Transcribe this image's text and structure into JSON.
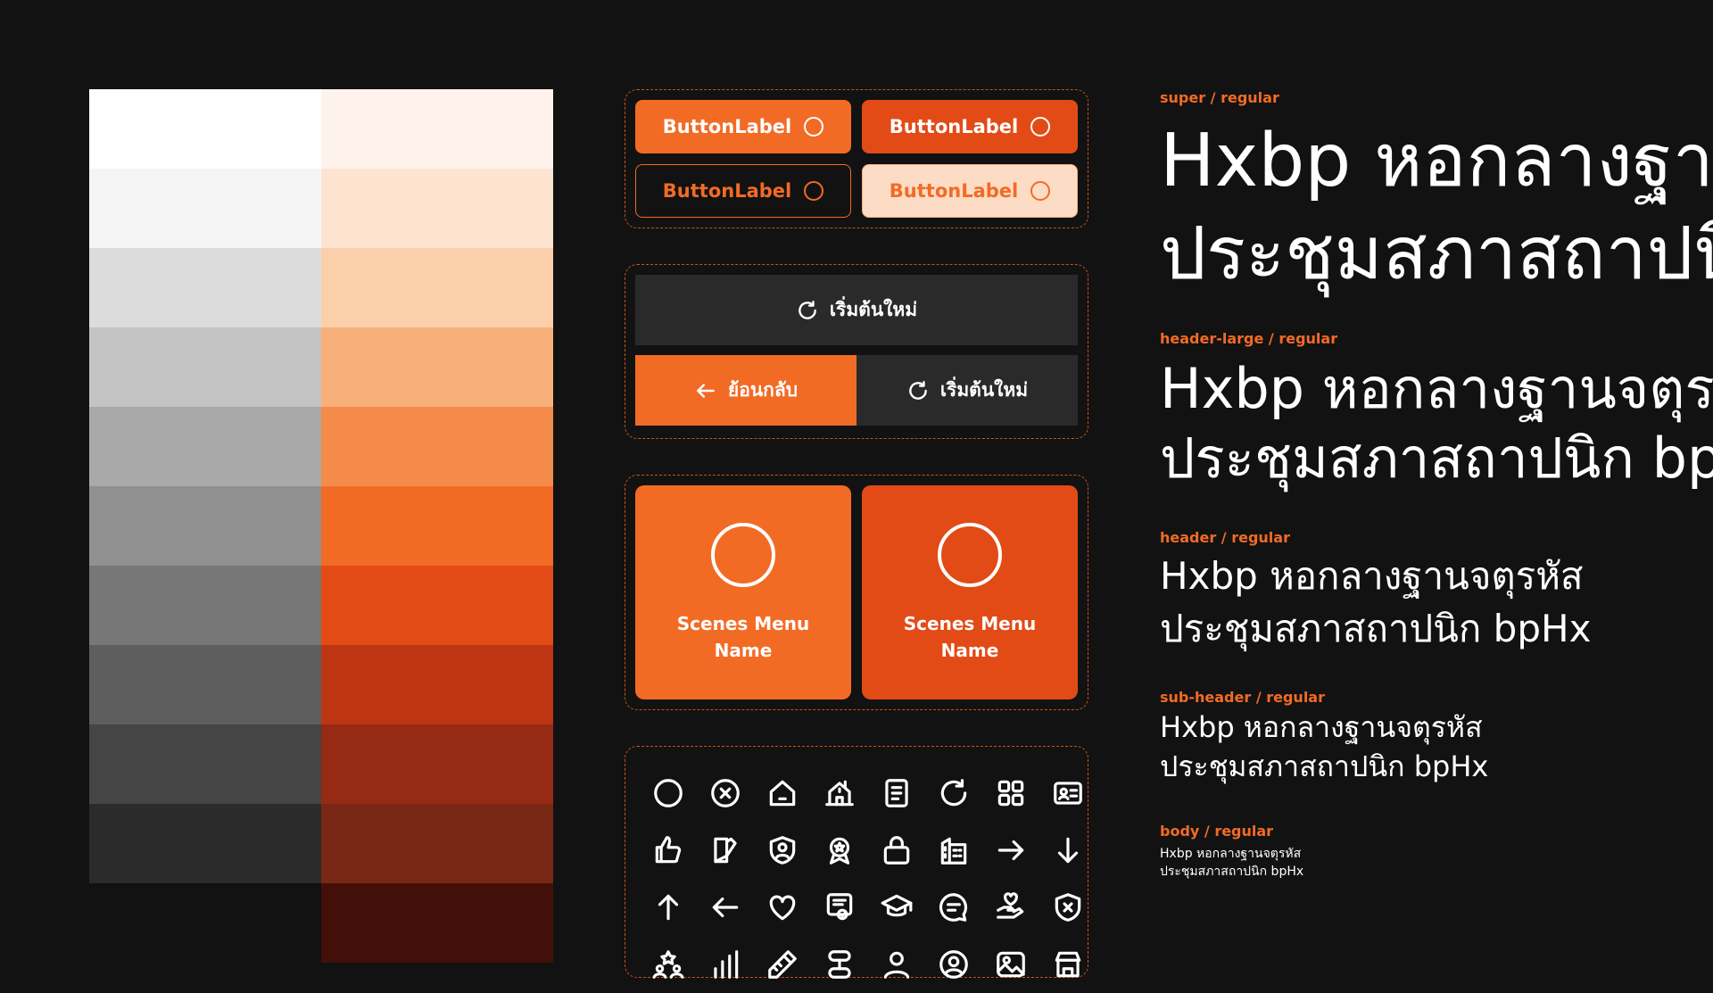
{
  "palette": {
    "gray": [
      "#ffffff",
      "#f5f5f5",
      "#dcdcdc",
      "#c3c3c3",
      "#a9a9a9",
      "#909090",
      "#777777",
      "#5e5e5e",
      "#454545",
      "#2b2b2b"
    ],
    "orange": [
      "#fef3ec",
      "#fde4d0",
      "#fbcfa9",
      "#f8b07b",
      "#f58b4a",
      "#f26b25",
      "#e24b16",
      "#bd3513",
      "#962a15",
      "#792815",
      "#421009"
    ]
  },
  "buttons": [
    {
      "label": "ButtonLabel",
      "style": "filled-orange"
    },
    {
      "label": "ButtonLabel",
      "style": "filled-deep-orange"
    },
    {
      "label": "ButtonLabel",
      "style": "outline"
    },
    {
      "label": "ButtonLabel",
      "style": "light"
    }
  ],
  "actions": {
    "restart_label": "เริ่มต้นใหม่",
    "back_label": "ย้อนกลับ",
    "restart_icon": "refresh-icon",
    "back_icon": "arrow-left-icon"
  },
  "tiles": [
    {
      "line1": "Scenes Menu",
      "line2": "Name"
    },
    {
      "line1": "Scenes Menu",
      "line2": "Name"
    }
  ],
  "icons": [
    "circle-icon",
    "close-circle-icon",
    "home-icon",
    "house-building-icon",
    "document-icon",
    "refresh-icon",
    "grid-icon",
    "id-card-icon",
    "thumbs-up-icon",
    "book-edit-icon",
    "shield-user-icon",
    "award-icon",
    "lock-icon",
    "office-building-icon",
    "arrow-right-icon",
    "arrow-down-icon",
    "arrow-up-icon",
    "arrow-left-icon",
    "heart-icon",
    "certificate-icon",
    "graduation-cap-icon",
    "chat-icon",
    "hand-heart-icon",
    "shield-close-icon",
    "group-star-icon",
    "bar-chart-icon",
    "pencil-ruler-icon",
    "stack-icon",
    "user-icon",
    "user-circle-icon",
    "image-icon",
    "store-icon"
  ],
  "typography": [
    {
      "label": "super / regular",
      "line1": "Hxbp หอกลางฐานจตุรหัส",
      "line2": "ประชุมสภาสถาปนิก bpHx"
    },
    {
      "label": "header-large / regular",
      "line1": "Hxbp หอกลางฐานจตุรหัส",
      "line2": "ประชุมสภาสถาปนิก bpHx"
    },
    {
      "label": "header / regular",
      "line1": "Hxbp หอกลางฐานจตุรหัส",
      "line2": "ประชุมสภาสถาปนิก bpHx"
    },
    {
      "label": "sub-header / regular",
      "line1": "Hxbp หอกลางฐานจตุรหัส",
      "line2": "ประชุมสภาสถาปนิก bpHx"
    },
    {
      "label": "body / regular",
      "line1": "Hxbp หอกลางฐานจตุรหัส",
      "line2": "ประชุมสภาสถาปนิก bpHx"
    }
  ],
  "colors": {
    "accent": "#f26b25",
    "accent_deep": "#e24b16",
    "background": "#121212",
    "surface": "#2a2a2a"
  }
}
